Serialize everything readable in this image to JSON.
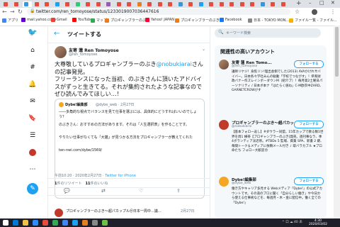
{
  "browser": {
    "url": "twitter.com/ren_tomoyose/status/1233019007036447616",
    "bookmarks": [
      {
        "label": "アプリ",
        "color": "#4285f4"
      },
      {
        "label": "mail.yahoo.co.jp",
        "color": "#6001d2"
      },
      {
        "label": "Gmail",
        "color": "#ea4335"
      },
      {
        "label": "YouTube",
        "color": "#ff0000"
      },
      {
        "label": "マップ",
        "color": "#34a853"
      },
      {
        "label": "プロギャンブラーのぶき",
        "color": "#e67e22"
      },
      {
        "label": "Yahoo! JAPAN",
        "color": "#ff0033"
      },
      {
        "label": "プロギャンブラーのぶき",
        "color": "#e67e22"
      },
      {
        "label": "Facebook",
        "color": "#1877f2"
      },
      {
        "label": "日本 - TOKYO MON...",
        "color": "#888888"
      },
      {
        "label": "ファイル一覧 - ファイル...",
        "color": "#f4b400"
      }
    ],
    "tab_colors": [
      "#e74c3c",
      "#e74c3c",
      "#3498db",
      "#e74c3c",
      "#e74c3c",
      "#1da1f2",
      "#e74c3c",
      "#2ecc71",
      "#e74c3c",
      "#e74c3c",
      "#9b59b6",
      "#e74c3c",
      "#e74c3c",
      "#e67e22",
      "#e74c3c",
      "#e74c3c",
      "#e74c3c",
      "#3498db",
      "#e74c3c",
      "#1da1f2",
      "#e74c3c",
      "#e74c3c",
      "#e74c3c",
      "#e74c3c",
      "#e74c3c",
      "#3498db",
      "#e74c3c",
      "#e74c3c"
    ]
  },
  "main": {
    "title": "ツイートする",
    "author": {
      "name": "友寄 蓮 Ren Tomoyose",
      "handle": "@ren_tomoyose"
    },
    "text_parts": {
      "pre": "大尊敬しているプロギャンブラーのぶき",
      "mention": "@nobukiarai",
      "post": "さんの記事発見。\nフリーランスになった当初、のぶきさんに頂いたアドバイスがずっと生きてる。それが集約されたような記事なのでぜひ読んでみてほしい…！"
    },
    "quote": {
      "name": "Dybe!編集部",
      "handle": "@dybe_web · 2月27日",
      "lines": [
        "――多角的な視点でバランスを見て仕事を選ぶには、具体的にどうすればいいのでしょう？",
        "のぶきさん：おすすめの方法があります。それは「人生選択表」を作ることです。",
        "やりたい仕事がなくても「大猫」が見つかる方法をプロギャンブラーが教えてくれた",
        "ten-nwi.com/dybe/1569/"
      ]
    },
    "meta_time": "午前10:20 · 2020年2月27日 · ",
    "meta_source": "Twitter for iPhone",
    "stats": {
      "retweets": "1",
      "retweets_label": "件のリツイート",
      "likes": "11",
      "likes_label": "件のいいね"
    },
    "reply": {
      "text": "プロギャンブラーのぶき〜超パカップル＠日本一周中…議…",
      "date": "2月27日"
    }
  },
  "right": {
    "search_placeholder": "キーワード検索",
    "related_title": "関連性の高いアカウント",
    "follow_label": "フォローする",
    "accounts": [
      {
        "name": "友寄 蓮 Ren Tomo...",
        "handle": "@ren_tomoyose",
        "bio": "議師リケジ！身焦リン!理出会側でした(2013) AVAかけれサバイバー。日本各々学社みんの勧動「学校でつながす」！県和財政バナー作ズレインボーダウンM（紹介ブ）！毎月第2土曜日パーソナリティ / 日本ボ本ナ「はたらく値ね」C-M欧衣中ZARD、GARNETCROWびす"
      },
      {
        "name": "プロギャンブラーのぶき〜超パカッ...",
        "handle": "@nobukiarai",
        "bio": "【基本フォロー返し】#ダウラー同盟。15年カップで教る数1世界を周1 横帯【プロギャンブラーのぶき]発売。週刊事なラ、季4ボランティア派近帯。#TBDx 5 監場、資業 SPA、新書 2 鍵、毎間トーク＆メディアに依頼メール付き ♪ 取バラカブル ★プロ命たち フォロー大歓迎😍"
      },
      {
        "name": "Dybe!編集部",
        "handle": "@dybe_web",
        "bio": "働き方やキャリア多見する Webメディア「Dybe!」の公式アカウントです。その道のプロに聞く「自分らしい働き」や今日から使える仕事術などを、毎週月・木・金に配信中。働く全ての「Dybe!」"
      }
    ]
  },
  "taskbar": {
    "tray": "^ 口 ☁ 40 あ",
    "time": "4:30",
    "date": "2020/03/02",
    "colors": [
      "#ffffff",
      "#0078d7",
      "#f0c24b",
      "#2d8cff",
      "#e74c3c",
      "#34a853",
      "#4285f4",
      "#1da1f2",
      "#e67e22",
      "#888888",
      "#6bc04b"
    ]
  }
}
